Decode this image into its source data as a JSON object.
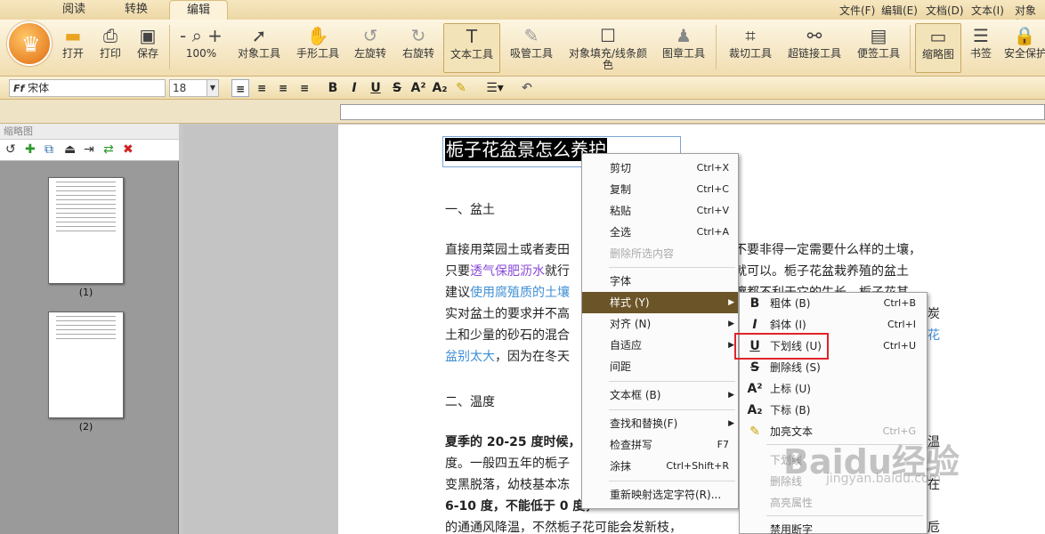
{
  "tabs": [
    "阅读",
    "转换",
    "编辑"
  ],
  "menu": [
    "文件(F)",
    "编辑(E)",
    "文档(D)",
    "文本(I)",
    "对象(O"
  ],
  "ribbon": [
    {
      "label": "打开",
      "icon": "folder-icon"
    },
    {
      "label": "打印",
      "icon": "printer-icon"
    },
    {
      "label": "保存",
      "icon": "save-icon"
    },
    {
      "label": "100%",
      "icon": "zoom-icon"
    },
    {
      "label": "对象工具",
      "icon": "cursor-icon"
    },
    {
      "label": "手形工具",
      "icon": "hand-icon"
    },
    {
      "label": "左旋转",
      "icon": "rotate-left-icon"
    },
    {
      "label": "右旋转",
      "icon": "rotate-right-icon"
    },
    {
      "label": "文本工具",
      "icon": "text-icon"
    },
    {
      "label": "吸管工具",
      "icon": "eyedropper-icon"
    },
    {
      "label": "对象填充/线条颜色",
      "icon": "fill-color-icon"
    },
    {
      "label": "图章工具",
      "icon": "stamp-icon"
    },
    {
      "label": "裁切工具",
      "icon": "crop-icon"
    },
    {
      "label": "超链接工具",
      "icon": "link-icon"
    },
    {
      "label": "便签工具",
      "icon": "note-icon"
    },
    {
      "label": "缩略图",
      "icon": "thumbnail-icon"
    },
    {
      "label": "书签",
      "icon": "bookmark-icon"
    },
    {
      "label": "安全保护",
      "icon": "lock-icon"
    }
  ],
  "format": {
    "font": "宋体",
    "size": "18",
    "font_icon": "Ff"
  },
  "panel": {
    "title": "缩略图",
    "pages": [
      "(1)",
      "(2)"
    ]
  },
  "doc": {
    "title": "栀子花盆景怎么养护",
    "h1": "一、盆土",
    "p1": [
      "直接用菜园土或者麦田",
      "只要",
      "透气保肥沥水",
      "就行",
      "建议",
      "使用腐殖质的土壤",
      "实对盆土的要求并不高",
      "土和少量的砂石的混合",
      "盆别太大",
      "，因为在冬天"
    ],
    "p1r": [
      "不要非得一定需要什么样的土壤，",
      "就可以。栀子花盆栽养殖的盆土",
      "壤都不利于它的生长。栀子花其",
      "炭",
      "花"
    ],
    "h2": "二、温度",
    "p2": [
      "夏季的 20-25 度时候，",
      "度。一般四五年的栀子",
      "变黑脱落，幼枝基本冻",
      "6-10 度，不能低于 0 度，",
      "的通通风降温，不然栀子花可能会发新枝，"
    ],
    "p2r": [
      "温",
      "在",
      "卮"
    ]
  },
  "context_menu": [
    {
      "label": "剪切",
      "shortcut": "Ctrl+X"
    },
    {
      "label": "复制",
      "shortcut": "Ctrl+C"
    },
    {
      "label": "粘贴",
      "shortcut": "Ctrl+V"
    },
    {
      "label": "全选",
      "shortcut": "Ctrl+A"
    },
    {
      "label": "删除所选内容",
      "shortcut": ""
    },
    {
      "label": "字体",
      "shortcut": ""
    },
    {
      "label": "样式 (Y)",
      "shortcut": ""
    },
    {
      "label": "对齐 (N)",
      "shortcut": ""
    },
    {
      "label": "自适应",
      "shortcut": ""
    },
    {
      "label": "间距",
      "shortcut": ""
    },
    {
      "label": "文本框 (B)",
      "shortcut": ""
    },
    {
      "label": "查找和替换(F)",
      "shortcut": ""
    },
    {
      "label": "检查拼写",
      "shortcut": "F7"
    },
    {
      "label": "涂抹",
      "shortcut": "Ctrl+Shift+R"
    },
    {
      "label": "重新映射选定字符(R)...",
      "shortcut": ""
    }
  ],
  "submenu": [
    {
      "label": "粗体 (B)",
      "shortcut": "Ctrl+B",
      "icon": "B"
    },
    {
      "label": "斜体 (I)",
      "shortcut": "Ctrl+I",
      "icon": "I"
    },
    {
      "label": "下划线 (U)",
      "shortcut": "Ctrl+U",
      "icon": "U"
    },
    {
      "label": "删除线 (S)",
      "shortcut": "",
      "icon": "S"
    },
    {
      "label": "上标 (U)",
      "shortcut": "",
      "icon": "A²"
    },
    {
      "label": "下标 (B)",
      "shortcut": "",
      "icon": "A₂"
    },
    {
      "label": "加亮文本",
      "shortcut": "Ctrl+G",
      "icon": "✎"
    },
    {
      "label": "下划线",
      "shortcut": "",
      "icon": ""
    },
    {
      "label": "删除线",
      "shortcut": "",
      "icon": ""
    },
    {
      "label": "高亮属性",
      "shortcut": "",
      "icon": ""
    },
    {
      "label": "禁用断字",
      "shortcut": "",
      "icon": ""
    }
  ],
  "watermark": {
    "main": "Baidu经验",
    "sub": "jingyan.baidu.com"
  }
}
